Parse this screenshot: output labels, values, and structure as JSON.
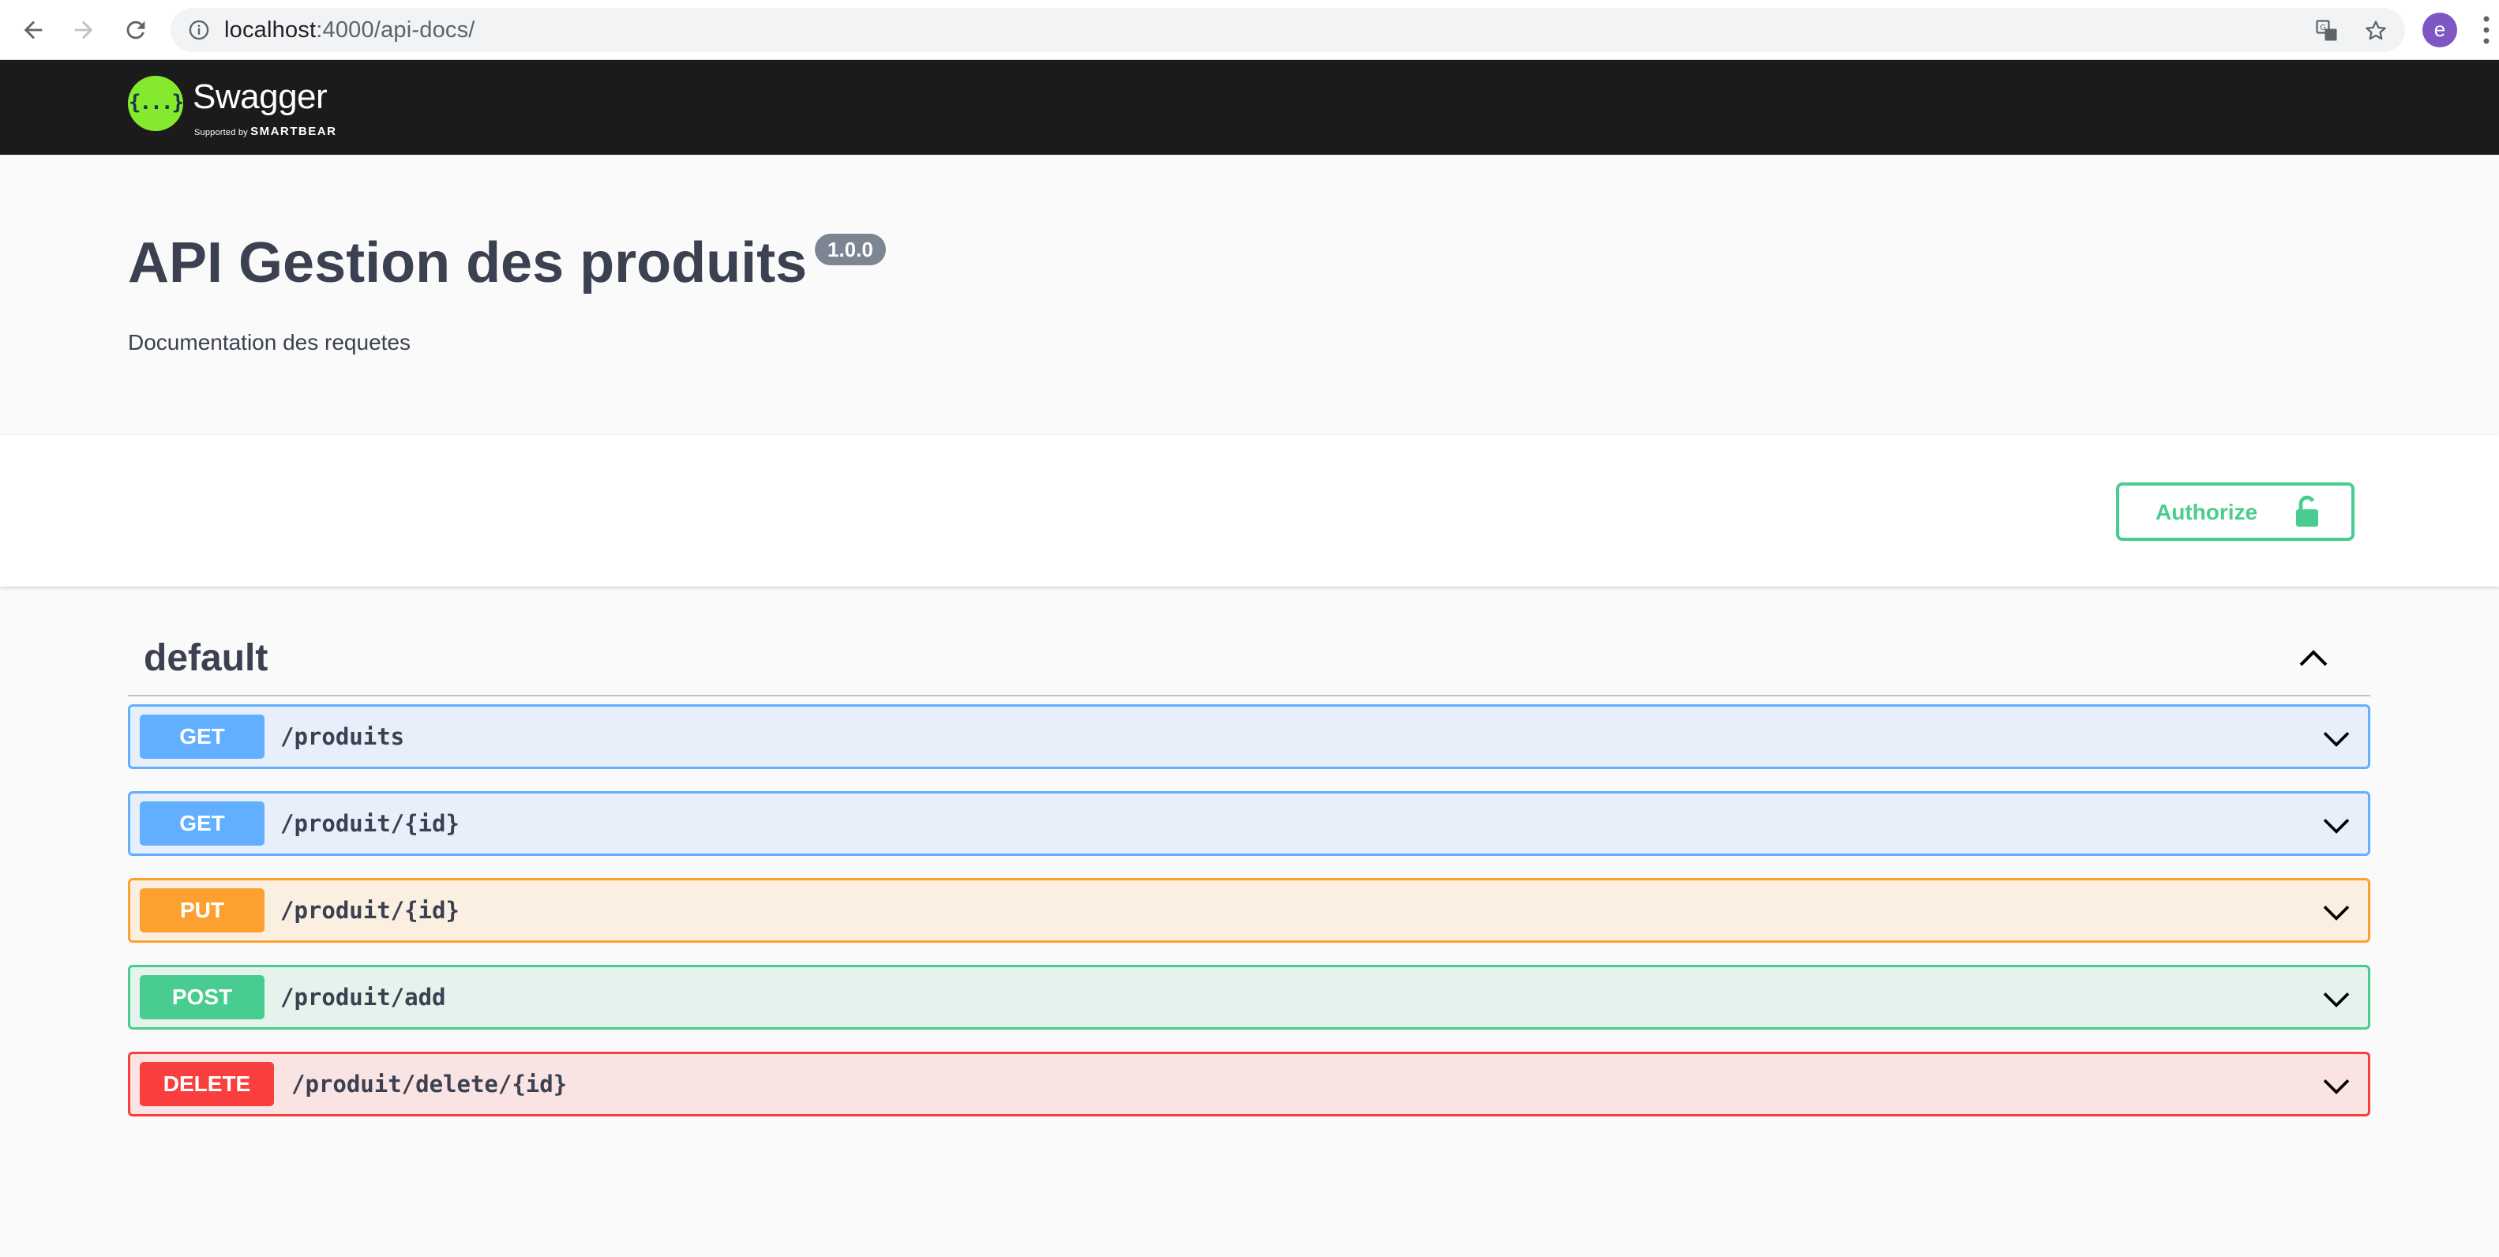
{
  "browser": {
    "url_host": "localhost",
    "url_rest": ":4000/api-docs/",
    "avatar_letter": "e",
    "icons": [
      "back-arrow-icon",
      "forward-arrow-icon",
      "reload-icon",
      "info-icon",
      "translate-icon",
      "star-icon",
      "kebab-menu-icon"
    ]
  },
  "topbar": {
    "logo_mark": "{...}",
    "logo_text": "Swagger",
    "logo_sub_prefix": "Supported by ",
    "logo_sub_brand": "SMARTBEAR"
  },
  "info": {
    "title": "API Gestion des produits",
    "version": "1.0.0",
    "description": "Documentation des requetes"
  },
  "scheme": {
    "authorize_label": "Authorize"
  },
  "tag": {
    "name": "default"
  },
  "operations": [
    {
      "method": "GET",
      "path": "/produits"
    },
    {
      "method": "GET",
      "path": "/produit/{id}"
    },
    {
      "method": "PUT",
      "path": "/produit/{id}"
    },
    {
      "method": "POST",
      "path": "/produit/add"
    },
    {
      "method": "DELETE",
      "path": "/produit/delete/{id}"
    }
  ],
  "colors": {
    "get": "#61affe",
    "put": "#fca130",
    "post": "#49cc90",
    "delete": "#f93e3e",
    "topbar": "#1b1b1b",
    "logo": "#85ea2d"
  }
}
